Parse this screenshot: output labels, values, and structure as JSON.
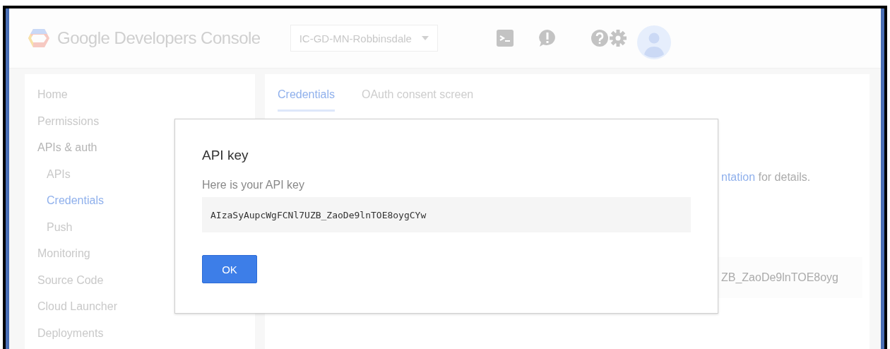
{
  "header": {
    "logo_text": "Google Developers Console",
    "project": "IC-GD-MN-Robbinsdale"
  },
  "sidebar": {
    "items": [
      {
        "label": "Home",
        "selected": false
      },
      {
        "label": "Permissions",
        "selected": false
      },
      {
        "label": "APIs & auth",
        "selected": false,
        "children": [
          {
            "label": "APIs",
            "selected": false
          },
          {
            "label": "Credentials",
            "selected": true
          },
          {
            "label": "Push",
            "selected": false
          }
        ]
      },
      {
        "label": "Monitoring",
        "selected": false
      },
      {
        "label": "Source Code",
        "selected": false
      },
      {
        "label": "Cloud Launcher",
        "selected": false
      },
      {
        "label": "Deployments",
        "selected": false
      }
    ]
  },
  "tabs": [
    {
      "label": "Credentials",
      "selected": true
    },
    {
      "label": "OAuth consent screen",
      "selected": false
    }
  ],
  "background": {
    "link": "ntation",
    "text": "for details.",
    "key_partial": "ZB_ZaoDe9lnTOE8oyg"
  },
  "dialog": {
    "title": "API key",
    "subtitle": "Here is your API key",
    "key": "AIzaSyAupcWgFCNl7UZB_ZaoDe9lnTOE8oygCYw",
    "button": "OK"
  }
}
